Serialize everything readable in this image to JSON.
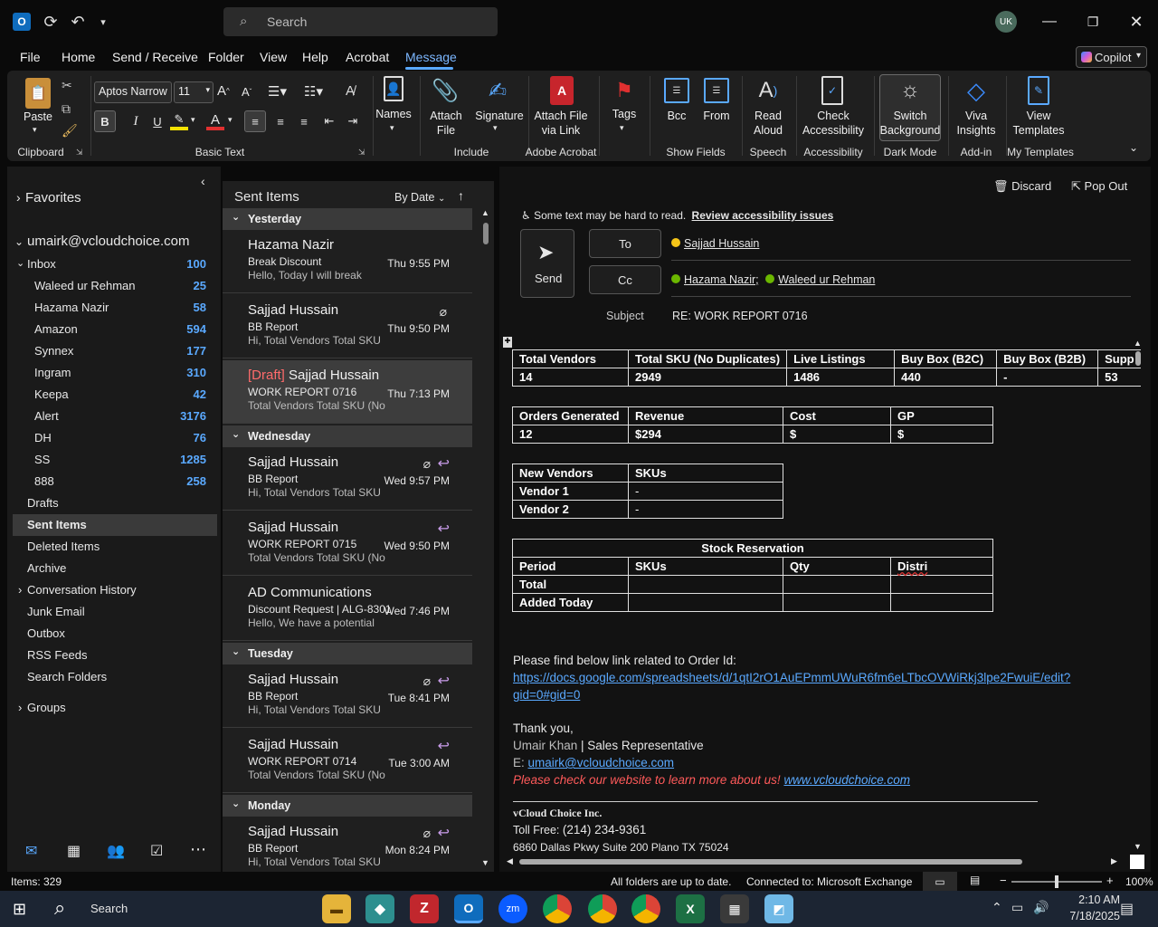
{
  "titlebar": {
    "search_placeholder": "Search",
    "avatar_initials": "UK"
  },
  "menu": [
    "File",
    "Home",
    "Send / Receive",
    "Folder",
    "View",
    "Help",
    "Acrobat",
    "Message"
  ],
  "active_menu": "Message",
  "copilot_label": "Copilot",
  "ribbon": {
    "paste": "Paste",
    "font_name": "Aptos Narrow",
    "font_size": "11",
    "names": "Names",
    "attach_file": [
      "Attach",
      "File"
    ],
    "signature": "Signature",
    "attach_link": [
      "Attach File",
      "via Link"
    ],
    "tags": "Tags",
    "bcc": "Bcc",
    "from": "From",
    "read_aloud": [
      "Read",
      "Aloud"
    ],
    "check_accessibility": [
      "Check",
      "Accessibility"
    ],
    "switch_background": [
      "Switch",
      "Background"
    ],
    "viva_insights": [
      "Viva",
      "Insights"
    ],
    "view_templates": [
      "View",
      "Templates"
    ],
    "groups": {
      "clipboard": "Clipboard",
      "basic_text": "Basic Text",
      "include": "Include",
      "adobe_acrobat": "Adobe Acrobat",
      "show_fields": "Show Fields",
      "speech": "Speech",
      "accessibility": "Accessibility",
      "dark_mode": "Dark Mode",
      "add_in": "Add-in",
      "my_templates": "My Templates"
    }
  },
  "nav": {
    "favorites": "Favorites",
    "account": "umairk@vcloudchoice.com",
    "inbox": {
      "label": "Inbox",
      "count": "100"
    },
    "subfolders": [
      {
        "label": "Waleed ur Rehman",
        "count": "25"
      },
      {
        "label": "Hazama Nazir",
        "count": "58"
      },
      {
        "label": "Amazon",
        "count": "594"
      },
      {
        "label": "Synnex",
        "count": "177"
      },
      {
        "label": "Ingram",
        "count": "310"
      },
      {
        "label": "Keepa",
        "count": "42"
      },
      {
        "label": "Alert",
        "count": "3176"
      },
      {
        "label": "DH",
        "count": "76"
      },
      {
        "label": "SS",
        "count": "1285"
      },
      {
        "label": "888",
        "count": "258"
      }
    ],
    "folders": [
      "Drafts",
      "Sent Items",
      "Deleted Items",
      "Archive",
      "Conversation History",
      "Junk Email",
      "Outbox",
      "RSS Feeds",
      "Search Folders"
    ],
    "groups": "Groups"
  },
  "list": {
    "title": "Sent Items",
    "sort": "By Date",
    "groups": [
      "Yesterday",
      "Wednesday",
      "Tuesday",
      "Monday"
    ],
    "messages": [
      {
        "from": "Hazama Nazir",
        "subject": "Break Discount",
        "preview": "Hello,  Today I will break",
        "time": "Thu 9:55 PM"
      },
      {
        "from": "Sajjad Hussain",
        "subject": "BB Report",
        "preview": "Hi,  Total Vendors  Total SKU",
        "time": "Thu 9:50 PM"
      },
      {
        "draft": "[Draft]",
        "from": "Sajjad Hussain",
        "subject": "WORK REPORT 0716",
        "preview": "Total Vendors  Total SKU (No",
        "time": "Thu 7:13 PM"
      },
      {
        "from": "Sajjad Hussain",
        "subject": "BB Report",
        "preview": "Hi,  Total Vendors  Total SKU",
        "time": "Wed 9:57 PM"
      },
      {
        "from": "Sajjad Hussain",
        "subject": "WORK REPORT 0715",
        "preview": "Total Vendors  Total SKU (No",
        "time": "Wed 9:50 PM"
      },
      {
        "from": "AD Communications",
        "subject": "Discount Request | ALG-8301",
        "preview": "Hello,  We have a potential",
        "time": "Wed 7:46 PM"
      },
      {
        "from": "Sajjad Hussain",
        "subject": "BB Report",
        "preview": "Hi,  Total Vendors  Total SKU",
        "time": "Tue 8:41 PM"
      },
      {
        "from": "Sajjad Hussain",
        "subject": "WORK REPORT 0714",
        "preview": "Total Vendors  Total SKU (No",
        "time": "Tue 3:00 AM"
      },
      {
        "from": "Sajjad Hussain",
        "subject": "BB Report",
        "preview": "Hi,  Total Vendors  Total SKU",
        "time": "Mon 8:24 PM"
      }
    ]
  },
  "compose": {
    "discard": "Discard",
    "popout": "Pop Out",
    "access_warning": "Some text may be hard to read.",
    "access_link": "Review accessibility issues",
    "send": "Send",
    "to_btn": "To",
    "cc_btn": "Cc",
    "to": "Sajjad Hussain",
    "cc1": "Hazama Nazir;",
    "cc2": "Waleed ur Rehman",
    "subject_label": "Subject",
    "subject": "RE: WORK REPORT 0716",
    "t1": {
      "h": [
        "Total Vendors",
        "Total SKU (No Duplicates)",
        "Live Listings",
        "Buy Box (B2C)",
        "Buy Box (B2B)",
        "Supp"
      ],
      "v": [
        "14",
        "2949",
        "1486",
        "440",
        "-",
        "53"
      ]
    },
    "t2": {
      "h": [
        "Orders Generated",
        "Revenue",
        "Cost",
        "GP"
      ],
      "v": [
        "12",
        "$294",
        "$",
        "$"
      ]
    },
    "t3": {
      "h": [
        "New Vendors",
        "SKUs"
      ],
      "r1": [
        "Vendor 1",
        "-"
      ],
      "r2": [
        "Vendor 2",
        "-"
      ]
    },
    "t4": {
      "title": "Stock Reservation",
      "h": [
        "Period",
        "SKUs",
        "Qty",
        "Distri"
      ],
      "r1": "Total",
      "r2": "Added Today"
    },
    "body_line": "Please find below link related to Order Id:",
    "url1": "https://docs.google.com/spreadsheets/d/1qtI2rO1AuEPmmUWuR6fm6eLTbcOVWiRkj3lpe2FwuiE/edit?",
    "url2": "gid=0#gid=0",
    "thanks": "Thank you,",
    "sig_name": "Umair Khan",
    "sig_title": "Sales Representative",
    "sig_email_label": "E:",
    "sig_email": "umairk@vcloudchoice.com",
    "sig_promo": "Please check our website to learn more about us!",
    "sig_site": "www.vcloudchoice.com",
    "company": "vCloud Choice Inc.",
    "tollfree_label": "Toll Free:",
    "tollfree": "(214) 234-9361",
    "address": "6860 Dallas Pkwy Suite 200 Plano TX 75024"
  },
  "status": {
    "items": "Items: 329",
    "sync": "All folders are up to date.",
    "connected": "Connected to: Microsoft Exchange",
    "zoom": "100%"
  },
  "taskbar": {
    "search": "Search",
    "time": "2:10 AM",
    "date": "7/18/2025"
  }
}
